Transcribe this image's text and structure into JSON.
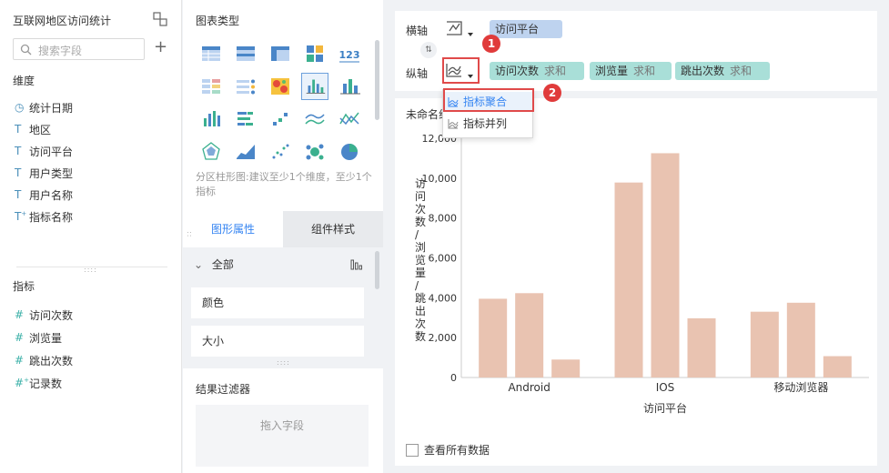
{
  "left": {
    "title": "互联网地区访问统计",
    "search_placeholder": "搜索字段",
    "dimensions_label": "维度",
    "dimensions": [
      {
        "icon": "clock-icon",
        "label": "统计日期"
      },
      {
        "icon": "text-icon",
        "label": "地区"
      },
      {
        "icon": "text-icon",
        "label": "访问平台"
      },
      {
        "icon": "text-icon",
        "label": "用户类型"
      },
      {
        "icon": "text-icon",
        "label": "用户名称"
      },
      {
        "icon": "text-calc-icon",
        "label": "指标名称"
      }
    ],
    "measures_label": "指标",
    "measures": [
      {
        "icon": "number-icon",
        "label": "访问次数"
      },
      {
        "icon": "number-icon",
        "label": "浏览量"
      },
      {
        "icon": "number-icon",
        "label": "跳出次数"
      },
      {
        "icon": "number-calc-icon",
        "label": "记录数"
      }
    ]
  },
  "middle": {
    "chart_types_title": "图表类型",
    "chart_type_hint": "分区柱形图:建议至少1个维度，至少1个指标",
    "tabs": [
      "图形属性",
      "组件样式"
    ],
    "all_label": "全部",
    "props": [
      "颜色",
      "大小"
    ],
    "filter_title": "结果过滤器",
    "filter_drop": "拖入字段"
  },
  "right": {
    "x_axis_label": "横轴",
    "y_axis_label": "纵轴",
    "x_fields": [
      {
        "name": "访问平台"
      }
    ],
    "y_fields": [
      {
        "name": "访问次数",
        "agg": "求和"
      },
      {
        "name": "浏览量",
        "agg": "求和"
      },
      {
        "name": "跳出次数",
        "agg": "求和"
      }
    ],
    "dropdown": [
      "指标聚合",
      "指标并列"
    ],
    "badges": [
      "1",
      "2"
    ],
    "chart_name": "未命名组",
    "show_all": "查看所有数据",
    "colors": {
      "bar": "#e9c3b1",
      "accent": "#3685f2",
      "badge": "#e03b3b"
    }
  },
  "chart_data": {
    "type": "bar",
    "categories": [
      "Android",
      "IOS",
      "移动浏览器"
    ],
    "series": [
      {
        "values": [
          3950,
          9780,
          3300
        ]
      },
      {
        "values": [
          4230,
          11250,
          3750
        ]
      },
      {
        "values": [
          900,
          2970,
          1070
        ]
      }
    ],
    "xlabel": "访问平台",
    "ylabel": "访问次数/浏览量/跳出次数",
    "yticks": [
      "0",
      "2,000",
      "4,000",
      "6,000",
      "8,000",
      "10,000",
      "12,000"
    ],
    "ylim": [
      0,
      12000
    ],
    "grid": false
  }
}
